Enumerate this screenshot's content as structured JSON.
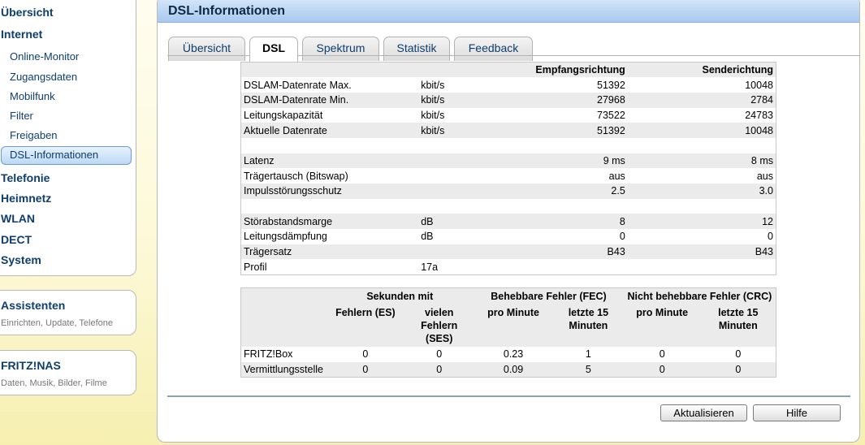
{
  "nav": {
    "items": [
      {
        "label": "Übersicht"
      },
      {
        "label": "Internet"
      },
      {
        "label": "Online-Monitor"
      },
      {
        "label": "Zugangsdaten"
      },
      {
        "label": "Mobilfunk"
      },
      {
        "label": "Filter"
      },
      {
        "label": "Freigaben"
      },
      {
        "label": "DSL-Informationen",
        "active": true
      },
      {
        "label": "Telefonie"
      },
      {
        "label": "Heimnetz"
      },
      {
        "label": "WLAN"
      },
      {
        "label": "DECT"
      },
      {
        "label": "System"
      }
    ],
    "assistenten": {
      "title": "Assistenten",
      "desc": "Einrichten, Update, Telefone"
    },
    "fritznas": {
      "title": "FRITZ!NAS",
      "desc": "Daten, Musik, Bilder, Filme"
    }
  },
  "panel": {
    "title": "DSL-Informationen",
    "tabs": [
      "Übersicht",
      "DSL",
      "Spektrum",
      "Statistik",
      "Feedback"
    ],
    "active_tab": "DSL"
  },
  "info_table": {
    "headers": [
      "",
      "",
      "Empfangsrichtung",
      "Senderichtung"
    ],
    "rows": [
      [
        "DSLAM-Datenrate Max.",
        "kbit/s",
        "51392",
        "10048"
      ],
      [
        "DSLAM-Datenrate Min.",
        "kbit/s",
        "27968",
        "2784"
      ],
      [
        "Leitungskapazität",
        "kbit/s",
        "73522",
        "24783"
      ],
      [
        "Aktuelle Datenrate",
        "kbit/s",
        "51392",
        "10048"
      ],
      [
        "",
        "",
        "",
        ""
      ],
      [
        "Latenz",
        "",
        "9 ms",
        "8 ms"
      ],
      [
        "Trägertausch (Bitswap)",
        "",
        "aus",
        "aus"
      ],
      [
        "Impulsstörungsschutz",
        "",
        "2.5",
        "3.0"
      ],
      [
        "",
        "",
        "",
        ""
      ],
      [
        "Störabstandsmarge",
        "dB",
        "8",
        "12"
      ],
      [
        "Leitungsdämpfung",
        "dB",
        "0",
        "0"
      ],
      [
        "Trägersatz",
        "",
        "B43",
        "B43"
      ],
      [
        "Profil",
        "17a",
        "",
        ""
      ]
    ]
  },
  "error_table": {
    "group_headers": [
      "Sekunden mit",
      "Behebbare Fehler (FEC)",
      "Nicht behebbare Fehler (CRC)"
    ],
    "sub_headers": [
      "Fehlern (ES)",
      "vielen Fehlern (SES)",
      "pro Minute",
      "letzte 15 Minuten",
      "pro Minute",
      "letzte 15 Minuten"
    ],
    "rows": [
      [
        "FRITZ!Box",
        "0",
        "0",
        "0.23",
        "1",
        "0",
        "0"
      ],
      [
        "Vermittlungsstelle",
        "0",
        "0",
        "0.09",
        "5",
        "0",
        "0"
      ]
    ]
  },
  "buttons": {
    "refresh": "Aktualisieren",
    "help": "Hilfe"
  }
}
